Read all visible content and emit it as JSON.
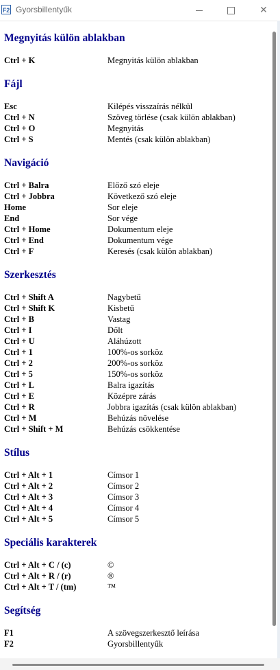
{
  "window": {
    "app_icon_text": "F2",
    "title": "Gyorsbillentyűk"
  },
  "sections": [
    {
      "title": "Megnyitás külön ablakban",
      "rows": [
        [
          "Ctrl + K",
          "Megnyitás külön ablakban"
        ]
      ]
    },
    {
      "title": "Fájl",
      "rows": [
        [
          "Esc",
          "Kilépés visszaírás nélkül"
        ],
        [
          "Ctrl + N",
          "Szöveg törlése (csak külön ablakban)"
        ],
        [
          "Ctrl + O",
          "Megnyitás"
        ],
        [
          "Ctrl + S",
          "Mentés (csak külön ablakban)"
        ]
      ]
    },
    {
      "title": "Navigáció",
      "rows": [
        [
          "Ctrl + Balra",
          "Előző szó eleje"
        ],
        [
          "Ctrl + Jobbra",
          "Következő szó eleje"
        ],
        [
          "Home",
          "Sor eleje"
        ],
        [
          "End",
          "Sor vége"
        ],
        [
          "Ctrl + Home",
          "Dokumentum eleje"
        ],
        [
          "Ctrl + End",
          "Dokumentum vége"
        ],
        [
          "Ctrl + F",
          "Keresés (csak külön ablakban)"
        ]
      ]
    },
    {
      "title": "Szerkesztés",
      "rows": [
        [
          "Ctrl + Shift A",
          "Nagybetű"
        ],
        [
          "Ctrl + Shift K",
          "Kisbetű"
        ],
        [
          "Ctrl + B",
          "Vastag"
        ],
        [
          "Ctrl + I",
          "Dőlt"
        ],
        [
          "Ctrl + U",
          "Aláhúzott"
        ],
        [
          "Ctrl + 1",
          "100%-os sorköz"
        ],
        [
          "Ctrl + 2",
          "200%-os sorköz"
        ],
        [
          "Ctrl + 5",
          "150%-os sorköz"
        ],
        [
          "Ctrl + L",
          "Balra igazítás"
        ],
        [
          "Ctrl + E",
          "Középre zárás"
        ],
        [
          "Ctrl + R",
          "Jobbra igazítás (csak külön ablakban)"
        ],
        [
          "Ctrl + M",
          "Behúzás növelése"
        ],
        [
          "Ctrl + Shift + M",
          "Behúzás csökkentése"
        ]
      ]
    },
    {
      "title": "Stílus",
      "rows": [
        [
          "Ctrl + Alt + 1",
          "Címsor 1"
        ],
        [
          "Ctrl + Alt + 2",
          "Címsor 2"
        ],
        [
          "Ctrl + Alt + 3",
          "Címsor 3"
        ],
        [
          "Ctrl + Alt + 4",
          "Címsor 4"
        ],
        [
          "Ctrl + Alt + 5",
          "Címsor 5"
        ]
      ]
    },
    {
      "title": "Speciális karakterek",
      "rows": [
        [
          "Ctrl + Alt + C / (c)",
          "©"
        ],
        [
          "Ctrl + Alt + R / (r)",
          "®"
        ],
        [
          "Ctrl + Alt + T / (tm)",
          "™"
        ]
      ]
    },
    {
      "title": "Segítség",
      "rows": [
        [
          "F1",
          "A szövegszerkesztő leírása"
        ],
        [
          "F2",
          "Gyorsbillentyűk"
        ]
      ]
    }
  ],
  "colors": {
    "section_title": "#00008b",
    "background": "#ffffff"
  }
}
